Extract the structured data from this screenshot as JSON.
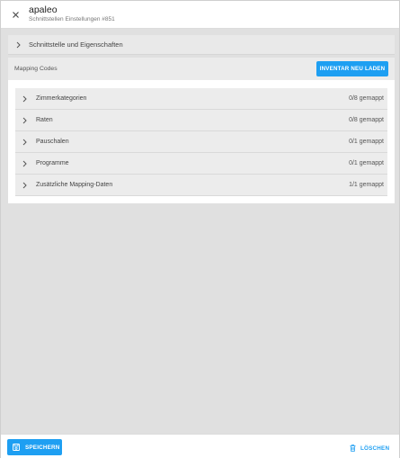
{
  "header": {
    "title": "apaleo",
    "subtitle": "Schnittstellen Einstellungen #851",
    "close_icon": "close-icon"
  },
  "sections": {
    "interface": {
      "label": "Schnittstelle und Eigenschaften",
      "icon": "chevron-right-icon"
    }
  },
  "mapping": {
    "title": "Mapping Codes",
    "reload_label": "INVENTAR NEU LADEN",
    "rows": [
      {
        "label": "Zimmerkategorien",
        "status": "0/8 gemappt"
      },
      {
        "label": "Raten",
        "status": "0/8 gemappt"
      },
      {
        "label": "Pauschalen",
        "status": "0/1 gemappt"
      },
      {
        "label": "Programme",
        "status": "0/1 gemappt"
      },
      {
        "label": "Zusätzliche Mapping-Daten",
        "status": "1/1 gemappt"
      }
    ]
  },
  "footer": {
    "save_label": "SPEICHERN",
    "save_icon": "floppy-disk-icon",
    "delete_label": "LÖSCHEN",
    "delete_icon": "trash-icon"
  },
  "colors": {
    "accent": "#1e9ff2",
    "background": "#e0e0e0"
  }
}
